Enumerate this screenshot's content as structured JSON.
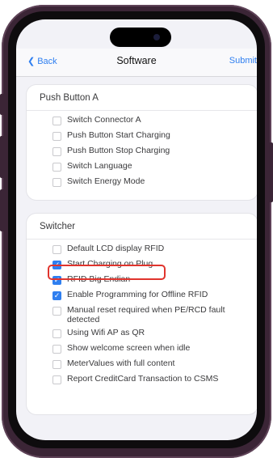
{
  "nav": {
    "back_label": "Back",
    "title": "Software",
    "submit_label": "Submit"
  },
  "push_button_a": {
    "title": "Push Button A",
    "options": [
      {
        "label": "Switch Connector A",
        "checked": false
      },
      {
        "label": "Push Button Start Charging",
        "checked": false
      },
      {
        "label": "Push Button Stop Charging",
        "checked": false
      },
      {
        "label": "Switch Language",
        "checked": false
      },
      {
        "label": "Switch Energy Mode",
        "checked": false
      }
    ]
  },
  "switcher": {
    "title": "Switcher",
    "options": [
      {
        "label": "Default LCD display RFID",
        "checked": false
      },
      {
        "label": "Start Charging on Plug",
        "checked": true
      },
      {
        "label": "RFID Big Endian",
        "checked": true
      },
      {
        "label": "Enable Programming for Offline RFID",
        "checked": true
      },
      {
        "label": "Manual reset required when PE/RCD fault detected",
        "checked": false
      },
      {
        "label": "Using Wifi AP as QR",
        "checked": false
      },
      {
        "label": "Show welcome screen when idle",
        "checked": false
      },
      {
        "label": "MeterValues with full content",
        "checked": false
      },
      {
        "label": "Report CreditCard Transaction to CSMS",
        "checked": false
      }
    ]
  },
  "colors": {
    "accent": "#2f7ff0",
    "highlight": "#e0342d",
    "frame": "#3b2536"
  },
  "icons": {
    "back": "chevron-left-icon",
    "checkmark": "checkmark-icon"
  }
}
